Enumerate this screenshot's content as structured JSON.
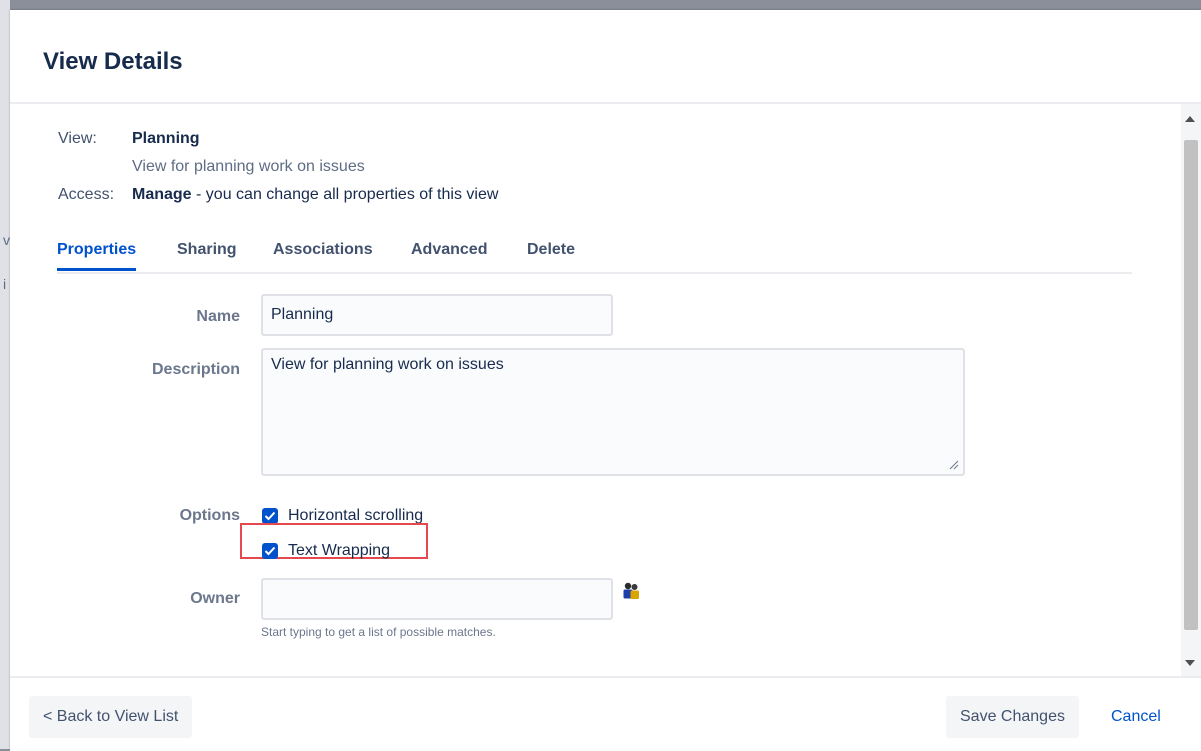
{
  "backdrop": {
    "fragment_1": "v",
    "fragment_2": "i"
  },
  "dialog": {
    "title": "View Details"
  },
  "meta": {
    "view_label": "View:",
    "view_name": "Planning",
    "view_description": "View for planning work on issues",
    "access_label": "Access:",
    "access_level": "Manage",
    "access_note": " - you can change all properties of this view"
  },
  "tabs": [
    {
      "label": "Properties",
      "active": true
    },
    {
      "label": "Sharing",
      "active": false
    },
    {
      "label": "Associations",
      "active": false
    },
    {
      "label": "Advanced",
      "active": false
    },
    {
      "label": "Delete",
      "active": false
    }
  ],
  "form": {
    "name_label": "Name",
    "name_value": "Planning",
    "description_label": "Description",
    "description_value": "View for planning work on issues",
    "options_label": "Options",
    "options": [
      {
        "label": "Horizontal scrolling",
        "checked": true
      },
      {
        "label": "Text Wrapping",
        "checked": true
      }
    ],
    "owner_label": "Owner",
    "owner_value": "",
    "owner_help": "Start typing to get a list of possible matches.",
    "owner_picker_icon": "user-picker-icon"
  },
  "footer": {
    "back_label": "< Back to View List",
    "save_label": "Save Changes",
    "cancel_label": "Cancel"
  },
  "colors": {
    "accent": "#0052cc",
    "highlight": "#e5484d"
  }
}
